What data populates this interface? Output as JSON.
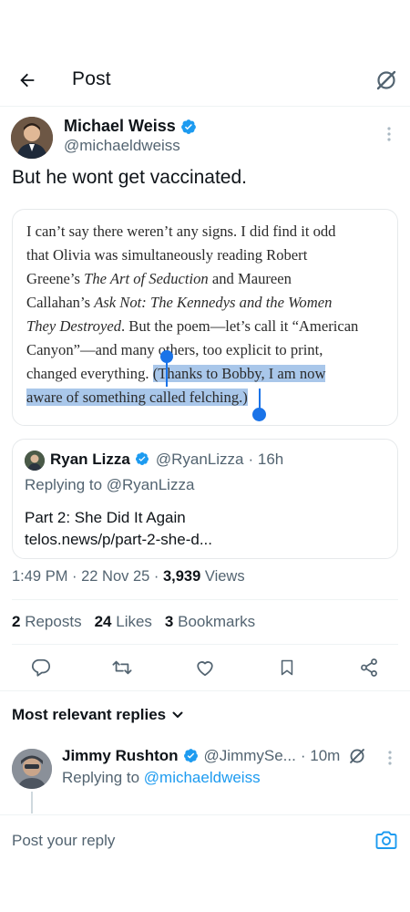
{
  "header": {
    "title": "Post",
    "back_icon": "arrow-left-icon",
    "grok_icon": "grok-icon"
  },
  "post": {
    "author_name": "Michael Weiss",
    "author_handle": "@michaeldweiss",
    "text": "But he wont get vaccinated.",
    "image_text": {
      "l1": "I can’t say there weren’t any signs. I did find it odd",
      "l2": "that Olivia was simultaneously reading Robert",
      "l3a": "Greene’s ",
      "l3b": "The Art of Seduction",
      "l3c": " and Maureen",
      "l4a": "Callahan’s ",
      "l4b": "Ask Not: The Kennedys and the Women",
      "l5a": "They Destroyed",
      "l5b": ". But the poem—let’s call it “American",
      "l6": "Canyon”—and many others, too explicit to print,",
      "l7a": "changed everything. ",
      "l7b": "(Thanks to Bobby, I am now",
      "l8": "aware of something called felching.)"
    },
    "quoted": {
      "name": "Ryan Lizza",
      "handle": "@RyanLizza",
      "time": "· 16h",
      "replying": "Replying to @RyanLizza",
      "line1": "Part 2: She Did It Again",
      "line2": "telos.news/p/part-2-she-d..."
    },
    "time": "1:49 PM · 22 Nov 25 · ",
    "views_count": "3,939",
    "views_label": " Views",
    "stats": {
      "reposts_count": "2",
      "reposts_label": "Reposts",
      "likes_count": "24",
      "likes_label": "Likes",
      "bookmarks_count": "3",
      "bookmarks_label": "Bookmarks"
    }
  },
  "actions": [
    "reply-icon",
    "retweet-icon",
    "like-icon",
    "bookmark-icon",
    "share-icon"
  ],
  "replies": {
    "sort_label": "Most relevant replies",
    "items": [
      {
        "name": "Jimmy Rushton",
        "handle": "@JimmySe...",
        "time": "· 10m",
        "replying_prefix": "Replying to ",
        "replying_to": "@michaeldweiss"
      }
    ]
  },
  "composer": {
    "placeholder": "Post your reply"
  },
  "colors": {
    "accent": "#1d9bf0",
    "text": "#0f1419",
    "muted": "#536471",
    "selection": "#a9c7ea",
    "handle": "#1a73e8"
  }
}
